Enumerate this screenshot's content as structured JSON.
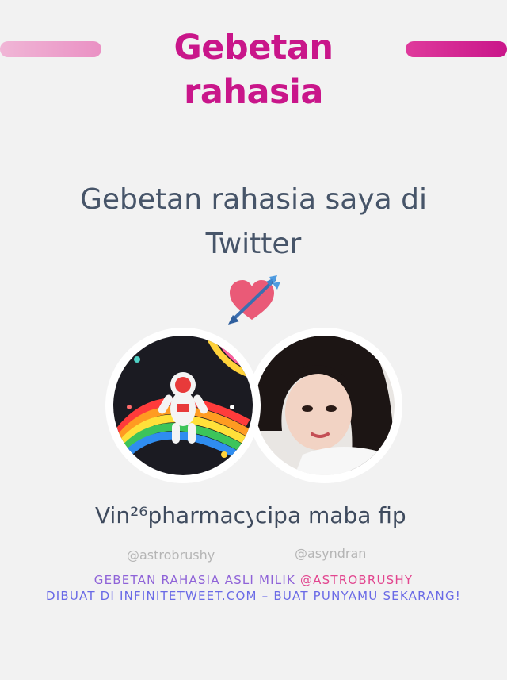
{
  "header": {
    "title": "Gebetan rahasia"
  },
  "headline": {
    "line1": "Gebetan rahasia saya di",
    "line2": "Twitter"
  },
  "users": [
    {
      "name": "Vin²⁶pharmacy",
      "handle": "@astrobrushy"
    },
    {
      "name": "cipa maba fip",
      "handle": "@asyndran"
    }
  ],
  "footer": {
    "owner_prefix": "GEBETAN RAHASIA ASLI MILIK ",
    "owner_handle": "@ASTROBRUSHY",
    "made_prefix": "DIBUAT DI ",
    "site": "INFINITETWEET.COM",
    "made_suffix": " – BUAT PUNYAMU SEKARANG!"
  },
  "icons": {
    "heart": "heart-arrow-icon"
  },
  "colors": {
    "brand": "#c9168a",
    "text": "#475569",
    "purple": "#8f63d8",
    "pink": "#e2468f",
    "blue": "#6a6ae6"
  }
}
